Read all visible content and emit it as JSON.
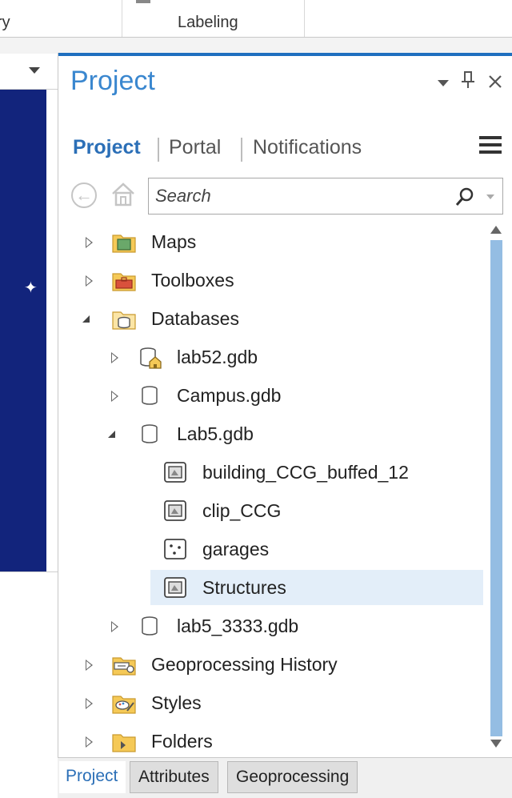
{
  "ribbon": {
    "left_label": "ry",
    "center_label": "Labeling"
  },
  "pane": {
    "title": "Project",
    "tabs": [
      {
        "label": "Project",
        "active": true
      },
      {
        "label": "Portal",
        "active": false
      },
      {
        "label": "Notifications",
        "active": false
      }
    ],
    "search": {
      "placeholder": "Search",
      "value": ""
    },
    "controls": [
      "dropdown-icon",
      "pin-icon",
      "close-icon"
    ],
    "accent_color": "#3a87cf"
  },
  "tree": {
    "items": [
      {
        "label": "Maps",
        "icon": "maps-folder-icon",
        "expanded": false
      },
      {
        "label": "Toolboxes",
        "icon": "toolbox-folder-icon",
        "expanded": false
      },
      {
        "label": "Databases",
        "icon": "databases-folder-icon",
        "expanded": true
      },
      {
        "label": "lab52.gdb",
        "icon": "default-geodatabase-icon",
        "expanded": false
      },
      {
        "label": "Campus.gdb",
        "icon": "geodatabase-icon",
        "expanded": false
      },
      {
        "label": "Lab5.gdb",
        "icon": "geodatabase-icon",
        "expanded": true
      },
      {
        "label": "building_CCG_buffed_12",
        "icon": "polygon-feature-class-icon"
      },
      {
        "label": "clip_CCG",
        "icon": "polygon-feature-class-icon"
      },
      {
        "label": "garages",
        "icon": "point-feature-class-icon"
      },
      {
        "label": "Structures",
        "icon": "polygon-feature-class-icon",
        "selected": true
      },
      {
        "label": "lab5_3333.gdb",
        "icon": "geodatabase-icon",
        "expanded": false
      },
      {
        "label": "Geoprocessing History",
        "icon": "geoprocessing-history-icon",
        "expanded": false
      },
      {
        "label": "Styles",
        "icon": "styles-folder-icon",
        "expanded": false
      },
      {
        "label": "Folders",
        "icon": "folders-icon",
        "expanded": false
      }
    ]
  },
  "bottom_tabs": [
    {
      "label": "Project",
      "active": true
    },
    {
      "label": "Attributes",
      "active": false
    },
    {
      "label": "Geoprocessing",
      "active": false
    }
  ],
  "colors": {
    "map_background": "#12247c",
    "selection": "#e3eef9",
    "scroll_thumb": "#94bde3"
  }
}
